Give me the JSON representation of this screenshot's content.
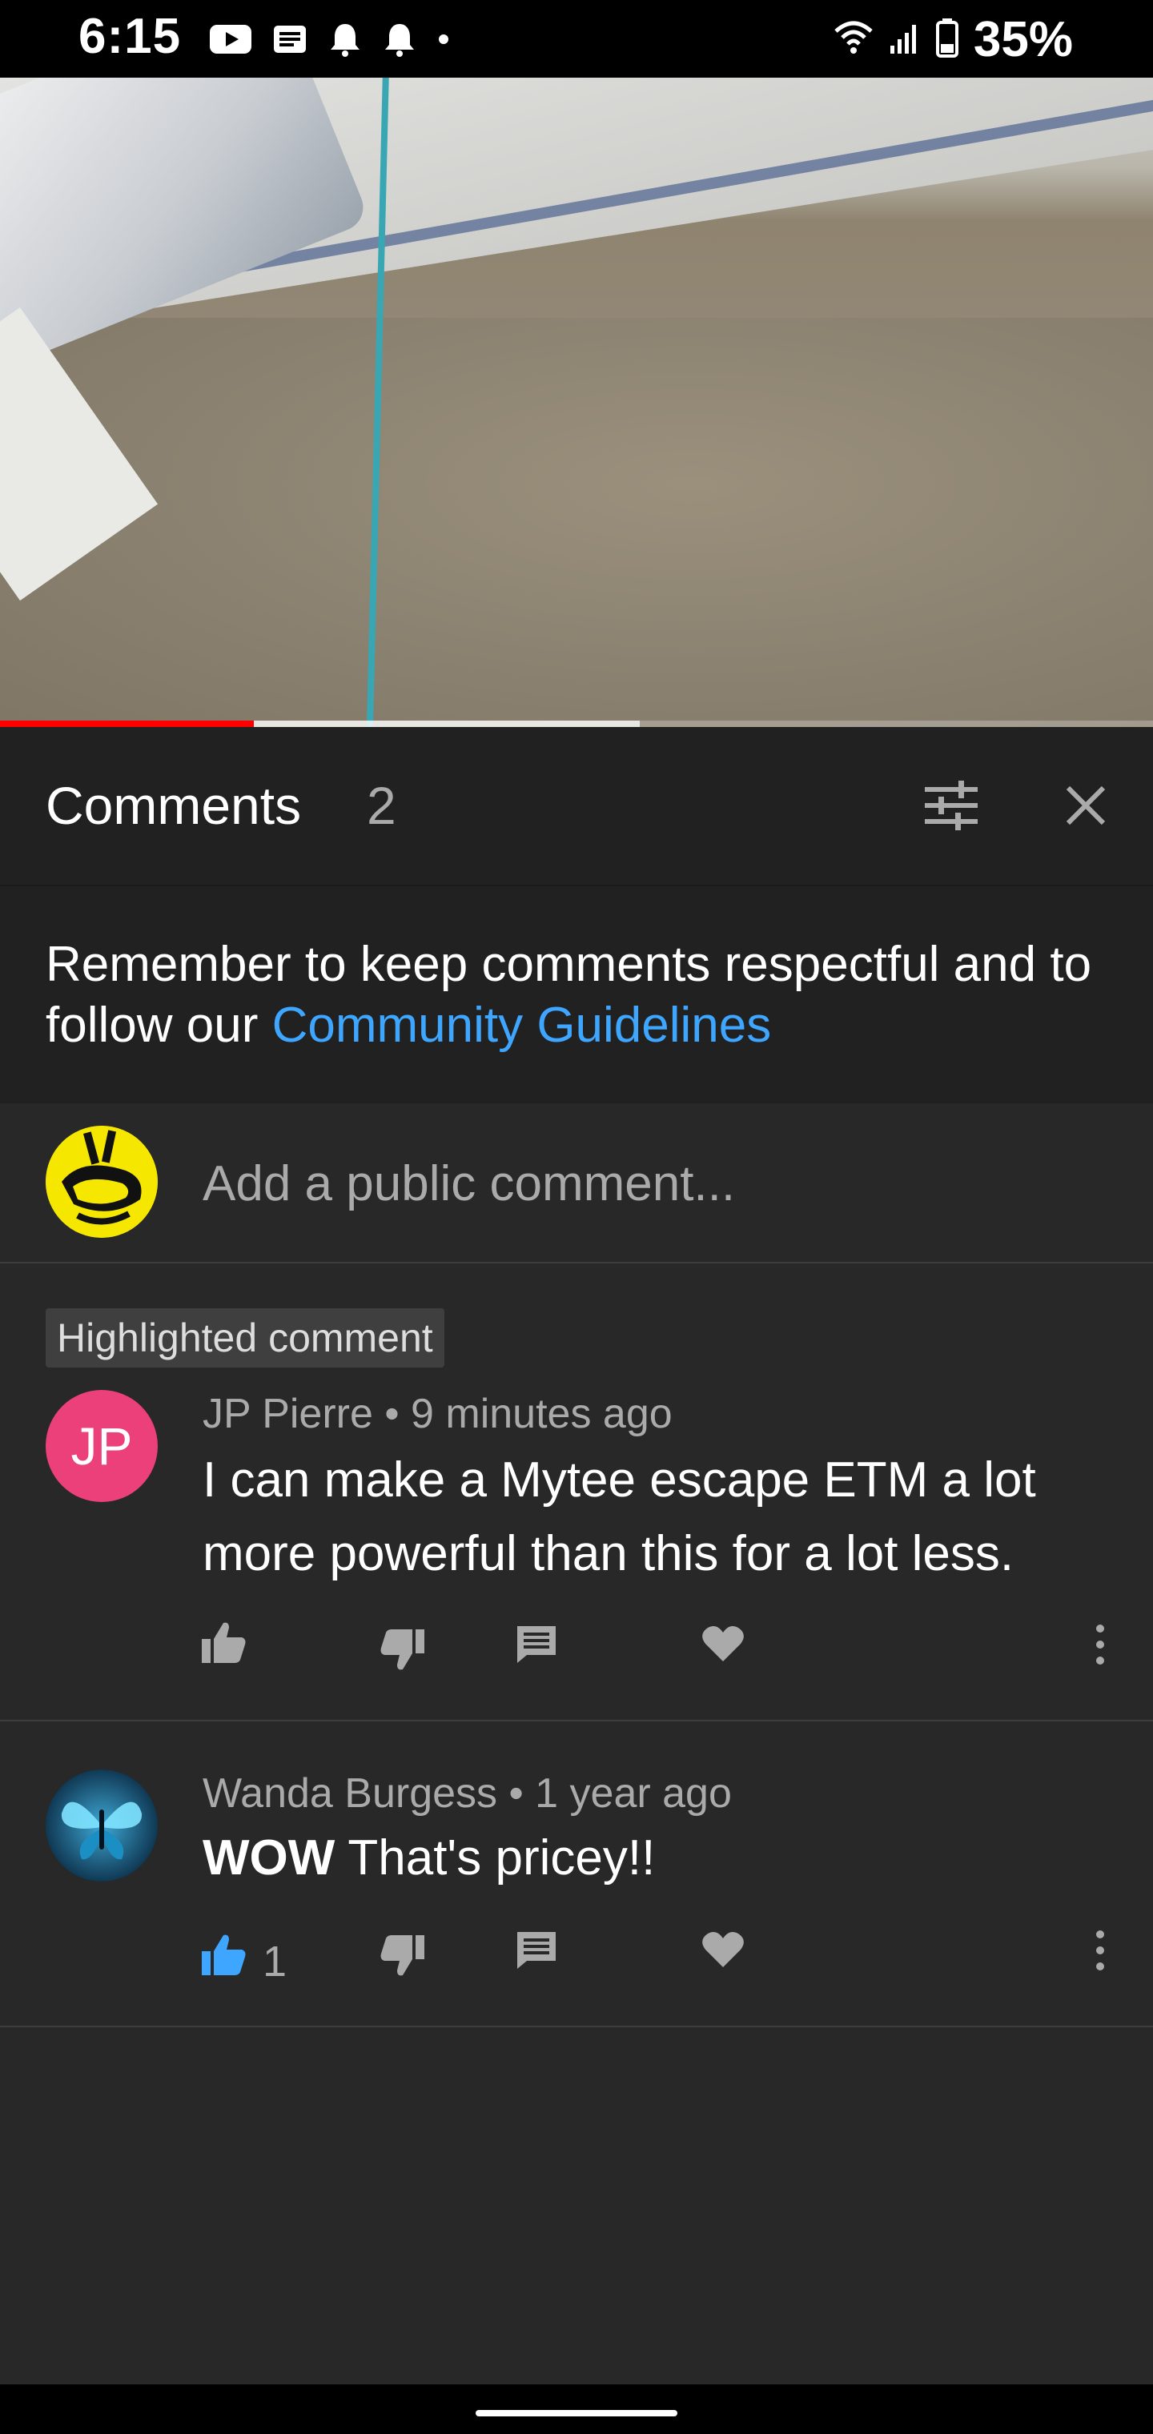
{
  "status_bar": {
    "time": "6:15",
    "battery": "35%",
    "icons": [
      "youtube-icon",
      "news-icon",
      "bell-icon",
      "bell-icon",
      "dot-icon",
      "wifi-icon",
      "signal-icon",
      "battery-icon"
    ]
  },
  "video": {
    "progress_played": 0.22,
    "progress_buffered": 0.555,
    "accent_color": "#ff0000"
  },
  "comments_panel": {
    "title": "Comments",
    "count": "2"
  },
  "guidelines": {
    "prefix": "Remember to keep comments respectful and to follow our ",
    "link_text": "Community Guidelines"
  },
  "add_comment": {
    "placeholder": "Add a public comment..."
  },
  "comments": [
    {
      "badge": "Highlighted comment",
      "avatar_initials": "JP",
      "avatar_color": "#ec407a",
      "author": "JP Pierre",
      "separator": " • ",
      "time": "9 minutes ago",
      "text": "I can make a Mytee escape ETM a lot more powerful than this for a lot less.",
      "likes": ""
    },
    {
      "avatar_image": "butterfly-avatar",
      "author": "Wanda Burgess",
      "separator": " • ",
      "time": "1 year ago",
      "text_bold": "WOW",
      "text": " That's pricey!!",
      "likes": "1",
      "liked_color": "#3ea6ff"
    }
  ]
}
